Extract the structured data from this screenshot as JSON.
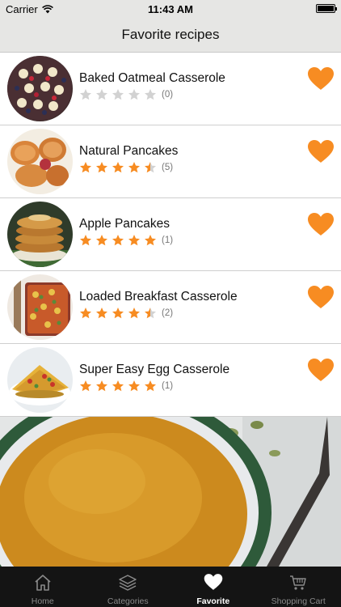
{
  "status_bar": {
    "carrier": "Carrier",
    "time": "11:43 AM",
    "battery_level": 1.0
  },
  "header": {
    "title": "Favorite recipes"
  },
  "recipes": [
    {
      "name": "Baked Oatmeal Casserole",
      "rating": 0,
      "count": "(0)",
      "favorite": true
    },
    {
      "name": "Natural Pancakes",
      "rating": 4.5,
      "count": "(5)",
      "favorite": true
    },
    {
      "name": "Apple Pancakes",
      "rating": 5,
      "count": "(1)",
      "favorite": true
    },
    {
      "name": "Loaded Breakfast Casserole",
      "rating": 4.5,
      "count": "(2)",
      "favorite": true
    },
    {
      "name": "Super Easy Egg Casserole",
      "rating": 5,
      "count": "(1)",
      "favorite": true
    }
  ],
  "tabs": [
    {
      "label": "Home",
      "icon": "home-icon",
      "active": false
    },
    {
      "label": "Categories",
      "icon": "layers-icon",
      "active": false
    },
    {
      "label": "Favorite",
      "icon": "heart-icon",
      "active": true
    },
    {
      "label": "Shopping Cart",
      "icon": "cart-icon",
      "active": false
    }
  ],
  "colors": {
    "accent": "#f78c22",
    "star_empty": "#d2d2d2",
    "header_bg": "#e6e6e4",
    "tab_bar_bg": "#141414",
    "tab_inactive": "#8a8a8a",
    "tab_active": "#ffffff"
  }
}
